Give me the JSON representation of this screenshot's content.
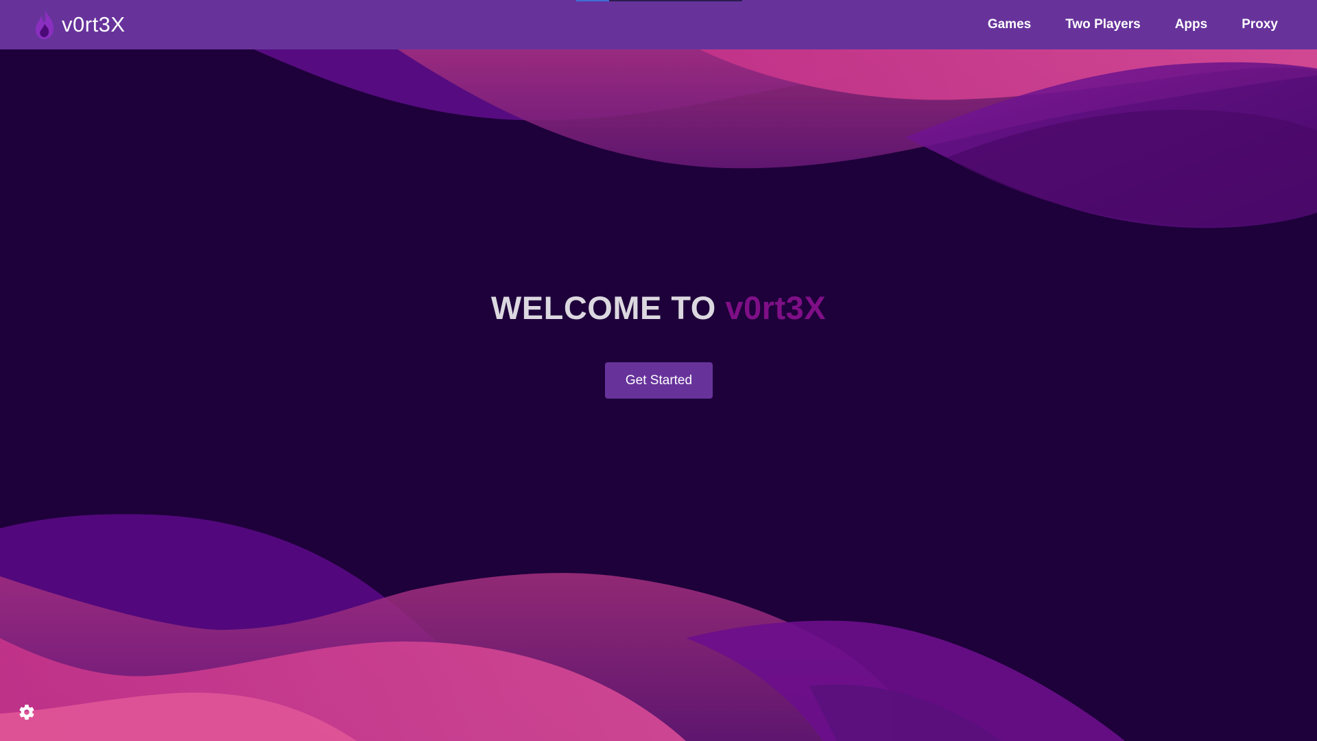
{
  "topbar": {
    "brand_name": "v0rt3X",
    "logo_icon": "flame-icon",
    "nav": [
      {
        "label": "Games"
      },
      {
        "label": "Two Players"
      },
      {
        "label": "Apps"
      },
      {
        "label": "Proxy"
      }
    ],
    "background_color": "#67339b"
  },
  "hero": {
    "title_prefix": "WELCOME TO",
    "title_brand": "v0rt3X",
    "cta_label": "Get Started",
    "background_color": "#1e003a",
    "accent_color": "#7f0f87"
  },
  "footer": {
    "settings_icon": "gear-icon"
  }
}
